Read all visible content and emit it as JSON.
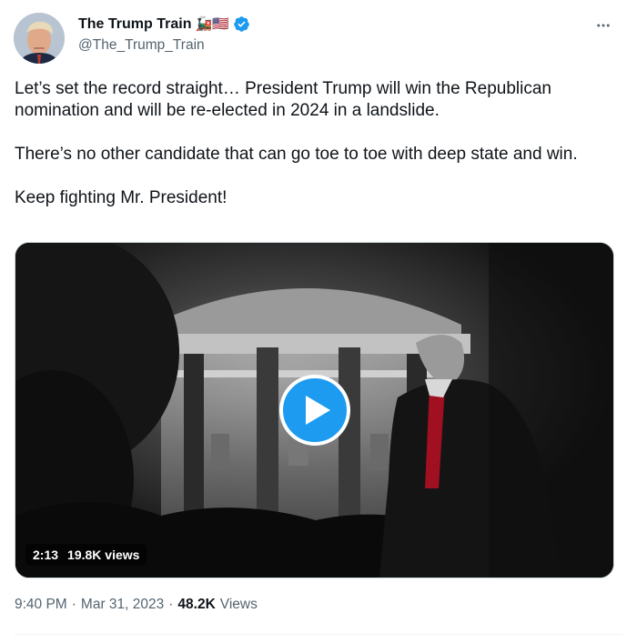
{
  "author": {
    "display_name": "The Trump Train",
    "name_emoji": "🚂🇺🇸",
    "handle": "@The_Trump_Train",
    "verified": true,
    "avatar_icon": "profile-photo"
  },
  "more_icon": "more-dots-icon",
  "text": {
    "p1": "Let’s set the record straight… President Trump will win the Republican nomination and will be re-elected in 2024 in a landslide.",
    "p2": "There’s no other candidate that can go toe to toe with deep state and win.",
    "p3": "Keep fighting Mr. President!"
  },
  "video": {
    "duration": "2:13",
    "views": "19.8K views",
    "play_icon": "play-icon"
  },
  "meta": {
    "time": "9:40 PM",
    "sep1": "·",
    "date": "Mar 31, 2023",
    "sep2": "·",
    "views_count": "48.2K",
    "views_label": "Views"
  },
  "colors": {
    "accent": "#1d9bf0",
    "text": "#0f1419",
    "secondary": "#536471"
  }
}
